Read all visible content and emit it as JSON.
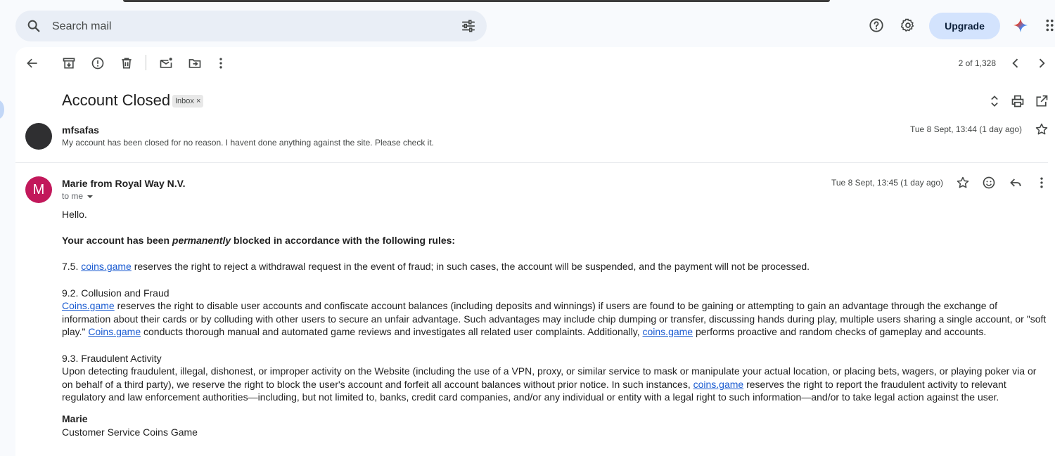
{
  "search": {
    "placeholder": "Search mail"
  },
  "header": {
    "upgrade_label": "Upgrade"
  },
  "toolbar": {
    "count": "2 of 1,328"
  },
  "thread": {
    "subject": "Account Closed",
    "label": "Inbox",
    "label_remove": "×"
  },
  "message1": {
    "sender": "mfsafas",
    "snippet": "My account has been closed for no reason. I havent done anything against the site. Please check it.",
    "date": "Tue 8 Sept, 13:44 (1 day ago)"
  },
  "message2": {
    "avatar_letter": "M",
    "sender": "Marie from Royal Way N.V.",
    "to": "to me",
    "date": "Tue 8 Sept, 13:45 (1 day ago)",
    "body": {
      "greeting": "Hello.",
      "heading_a": "Your account has been ",
      "heading_em": "permanently",
      "heading_b": " blocked in accordance with the following rules:",
      "r75_prefix": "7.5. ",
      "link": "coins.game",
      "link_cap": "Coins.game",
      "r75_text": " reserves the right to reject a withdrawal request in the event of fraud; in such cases, the account will be suspended, and the payment will not be processed.",
      "r92_title": "9.2. Collusion and Fraud",
      "r92_a": " reserves the right to disable user accounts and confiscate account balances (including deposits and winnings) if users are found to be gaining or attempting to gain an advantage through the exchange of information about their cards or by colluding with other users to secure an unfair advantage. Such advantages may include chip dumping or transfer, discussing hands during play, multiple users sharing a single account, or \"soft play.\" ",
      "r92_b": " conducts thorough manual and automated game reviews and investigates all related user complaints. Additionally, ",
      "r92_c": " performs proactive and random checks of gameplay and accounts.",
      "r93_title": "9.3. Fraudulent Activity",
      "r93_a": "Upon detecting fraudulent, illegal, dishonest, or improper activity on the Website (including the use of a VPN, proxy, or similar service to mask or manipulate your actual location, or placing bets, wagers, or playing poker via or on behalf of a third party), we reserve the right to block the user's account and forfeit all account balances without prior notice. In such instances, ",
      "r93_b": " reserves the right to report the fraudulent activity to relevant regulatory and law enforcement authorities—including, but not limited to, banks, credit card companies, and/or any individual or entity with a legal right to such information—and/or to take legal action against the user.",
      "sig_name": "Marie",
      "sig_title": "Customer Service Coins Game"
    }
  },
  "colors": {
    "accent": "#0b57d0",
    "avatar": "#c2185b",
    "link": "#1a5bd1",
    "upgrade_bg": "#d3e3fd"
  }
}
